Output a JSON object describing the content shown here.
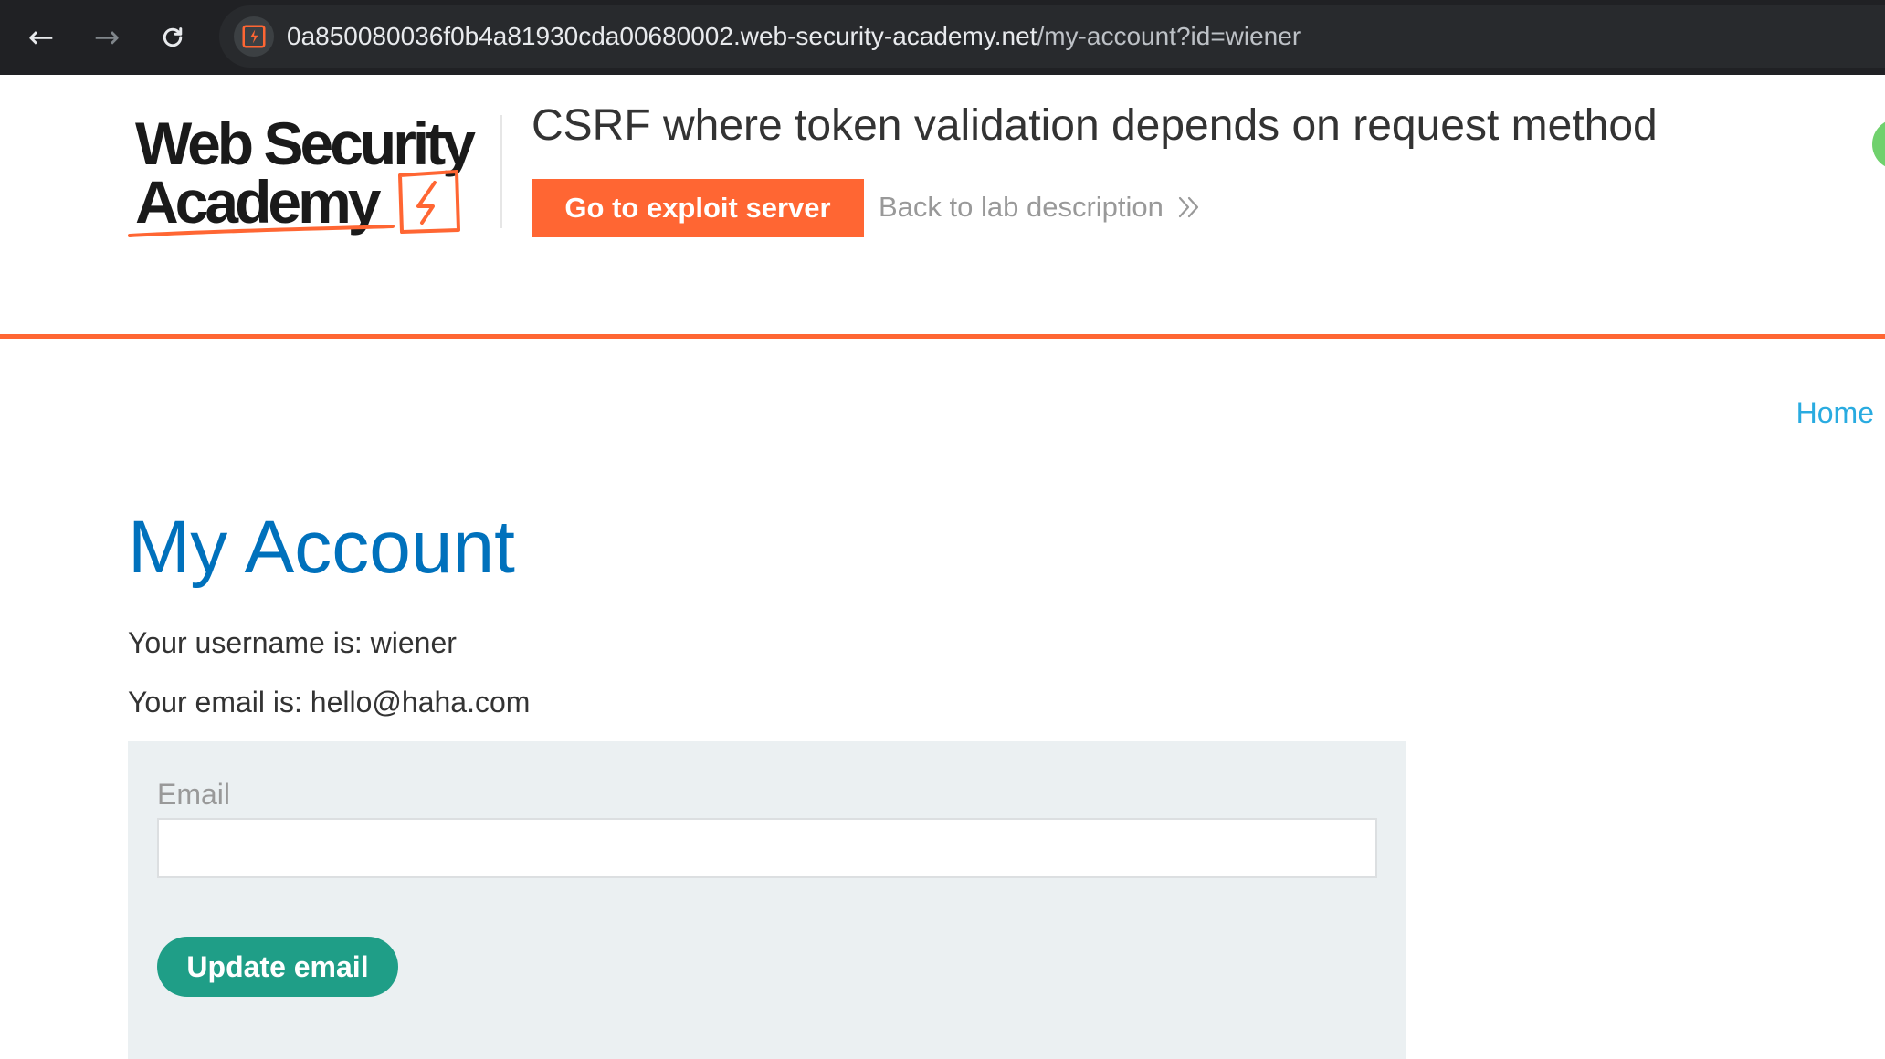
{
  "browser": {
    "url_host": "0a850080036f0b4a81930cda00680002.web-security-academy.net",
    "url_path": "/my-account?id=wiener",
    "back_icon": "arrow-left-icon",
    "forward_icon": "arrow-right-icon",
    "reload_icon": "reload-icon",
    "site_icon": "lightning-bolt-icon"
  },
  "header": {
    "logo_line1": "Web Security",
    "logo_line2": "Academy",
    "lab_title": "CSRF where token validation depends on request method",
    "exploit_button_label": "Go to exploit server",
    "back_link_label": "Back to lab description",
    "back_link_icon": "double-chevron-right-icon"
  },
  "nav": {
    "home_label": "Home"
  },
  "main": {
    "title": "My Account",
    "username_line": "Your username is: wiener",
    "email_line": "Your email is: hello@haha.com",
    "form": {
      "email_label": "Email",
      "email_value": "",
      "submit_label": "Update email"
    }
  },
  "colors": {
    "accent_orange": "#ff6633",
    "title_blue": "#0071bc",
    "link_blue": "#29abe0",
    "button_green": "#1f9e87",
    "panel_gray": "#ebf0f2",
    "status_green": "#70d16d"
  }
}
